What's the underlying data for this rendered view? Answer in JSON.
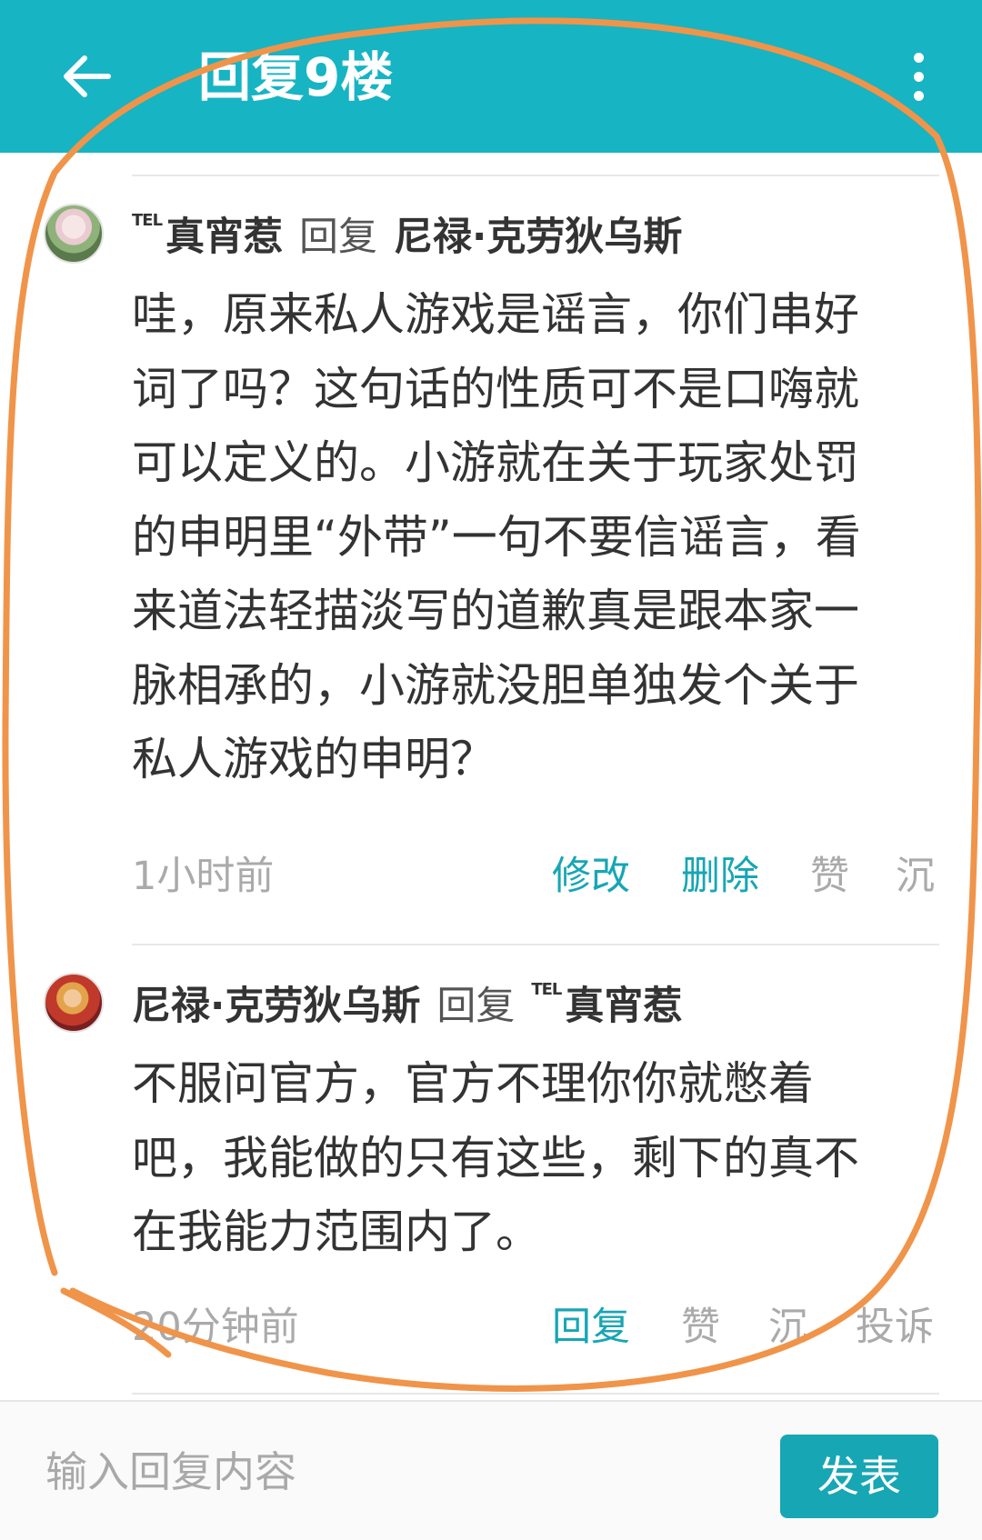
{
  "header": {
    "back_icon": "arrow-left-icon",
    "title": "回复9楼",
    "more_icon": "more-vertical-icon"
  },
  "replies": [
    {
      "avatar_icon": "user-avatar",
      "author_tag": "TEL",
      "author": "真宵惹",
      "reply_word": "回复",
      "target": "尼禄·克劳狄乌斯",
      "target_tag": "",
      "lines": [
        "哇，原来私人游戏是谣言，你们串好",
        "词了吗？这句话的性质可不是口嗨就",
        "可以定义的。小游就在关于玩家处罚",
        "的申明里“外带”一句不要信谣言，看",
        "来道法轻描淡写的道歉真是跟本家一",
        "脉相承的，小游就没胆单独发个关于",
        "私人游戏的申明？"
      ],
      "time": "1小时前",
      "actions": [
        "修改",
        "删除",
        "赞",
        "沉"
      ]
    },
    {
      "avatar_icon": "user-avatar",
      "author_tag": "",
      "author": "尼禄·克劳狄乌斯",
      "reply_word": "回复",
      "target": "真宵惹",
      "target_tag": "TEL",
      "lines": [
        "不服问官方，官方不理你你就憋着",
        "吧，我能做的只有这些，剩下的真不",
        "在我能力范围内了。"
      ],
      "time": "20分钟前",
      "actions": [
        "回复",
        "赞",
        "沉",
        "投诉"
      ]
    }
  ],
  "composer": {
    "placeholder": "输入回复内容",
    "send_label": "发表"
  },
  "colors": {
    "header_bg": "#17b4c3",
    "accent": "#17a6b4",
    "annotation": "#f0944a"
  }
}
